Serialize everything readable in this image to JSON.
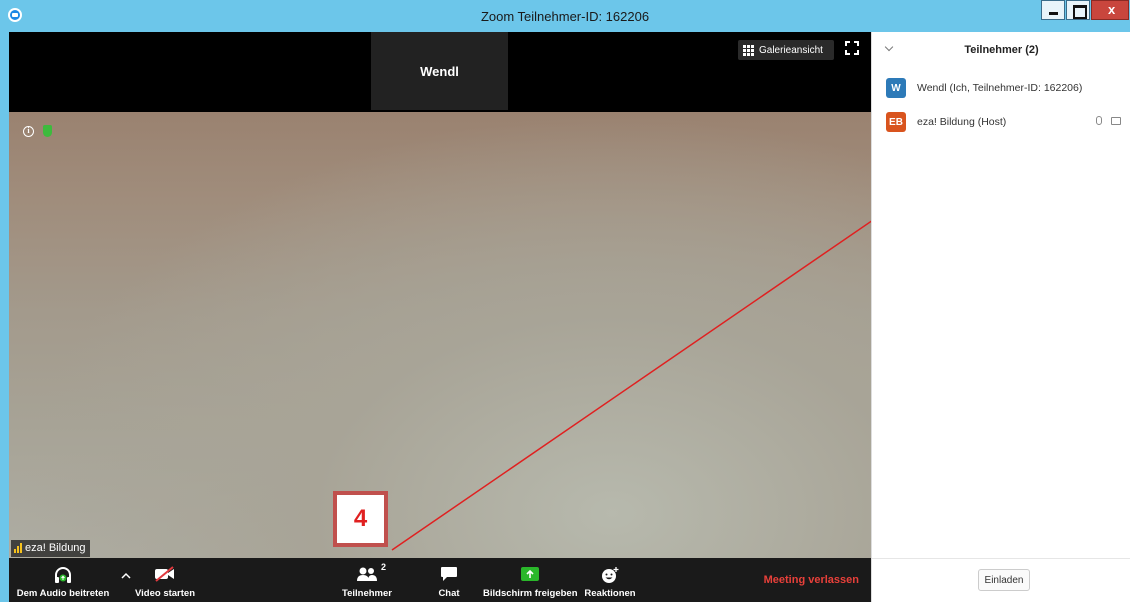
{
  "window": {
    "title": "Zoom Teilnehmer-ID: 162206"
  },
  "video": {
    "top_tile_name": "Wendl",
    "gallery_label": "Galerieansicht",
    "main_name_tag": "eza! Bildung"
  },
  "toolbar": {
    "audio_label": "Dem Audio beitreten",
    "video_label": "Video starten",
    "participants_label": "Teilnehmer",
    "participants_count": "2",
    "chat_label": "Chat",
    "share_label": "Bildschirm freigeben",
    "reactions_label": "Reaktionen",
    "leave_label": "Meeting verlassen"
  },
  "annotation": {
    "step_number": "4",
    "color": "#e02020"
  },
  "panel": {
    "title": "Teilnehmer (2)",
    "participants": [
      {
        "initials": "W",
        "name": "Wendl (Ich, Teilnehmer-ID: 162206)",
        "avatar_color": "#2d7ab8"
      },
      {
        "initials": "EB",
        "name": "eza! Bildung (Host)",
        "avatar_color": "#d9541e"
      }
    ],
    "invite_label": "Einladen"
  },
  "colors": {
    "titlebar": "#6cc6ea",
    "share_green": "#2ab72a",
    "leave_red": "#e8403a"
  }
}
